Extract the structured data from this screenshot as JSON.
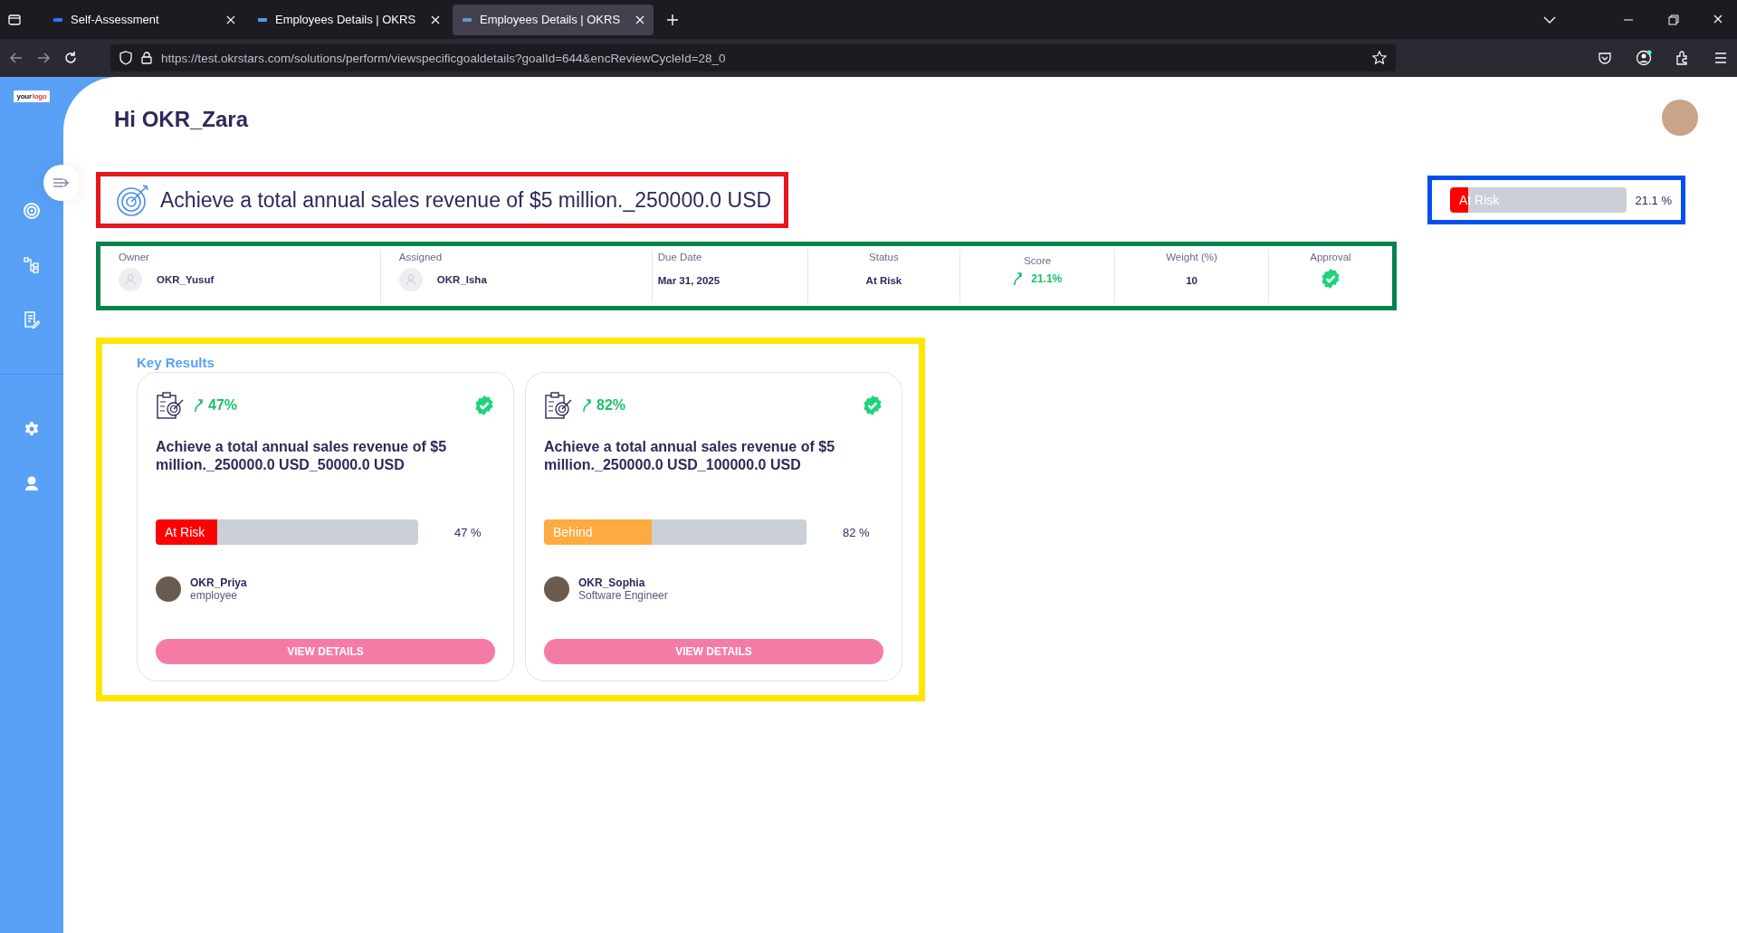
{
  "browser": {
    "tabs": [
      {
        "title": "Self-Assessment",
        "selected": false
      },
      {
        "title": "Employees Details | OKRS",
        "selected": false
      },
      {
        "title": "Employees Details | OKRS",
        "selected": true
      }
    ],
    "url": "https://test.okrstars.com/solutions/perform/viewspecificgoaldetails?goalId=644&encReviewCycleId=28_0"
  },
  "sidebar": {
    "logo": [
      "your",
      "logo"
    ],
    "items": [
      {
        "kind": "goal"
      },
      {
        "kind": "tree"
      },
      {
        "kind": "notes"
      },
      {
        "kind": "settings"
      },
      {
        "kind": "user"
      }
    ]
  },
  "greeting": "Hi OKR_Zara",
  "goal": {
    "title": "Achieve a total annual sales revenue of $5 million._250000.0 USD",
    "status": "At Risk",
    "color": "#ff0000",
    "level": 0.105,
    "percent": "21.1 %"
  },
  "details": [
    {
      "label": "Owner",
      "value": "OKR_Yusuf",
      "kind": "person"
    },
    {
      "label": "Assigned",
      "value": "OKR_Isha",
      "kind": "person"
    },
    {
      "label": "Due Date",
      "value": "Mar 31, 2025",
      "kind": "text"
    },
    {
      "label": "Status",
      "value": "At Risk",
      "kind": "center"
    },
    {
      "label": "Score",
      "value": "21.1%",
      "kind": "score"
    },
    {
      "label": "Weight (%)",
      "value": "10",
      "kind": "center"
    },
    {
      "label": "Approval",
      "kind": "approval",
      "approved": true
    }
  ],
  "key_results": {
    "title": "Key Results",
    "items": [
      {
        "score": "47%",
        "approved": true,
        "title": "Achieve a total annual sales revenue of $5 million._250000.0 USD_50000.0 USD",
        "status": "At Risk",
        "color": "#ff0000",
        "level": 0.235,
        "percent": "47 %",
        "person": "OKR_Priya",
        "role": "employee",
        "button": "VIEW DETAILS"
      },
      {
        "score": "82%",
        "approved": true,
        "title": "Achieve a total annual sales revenue of $5 million._250000.0 USD_100000.0 USD",
        "status": "Behind",
        "color": "#ffab40",
        "level": 0.41,
        "percent": "82 %",
        "person": "OKR_Sophia",
        "role": "Software Engineer",
        "button": "VIEW DETAILS"
      }
    ]
  }
}
